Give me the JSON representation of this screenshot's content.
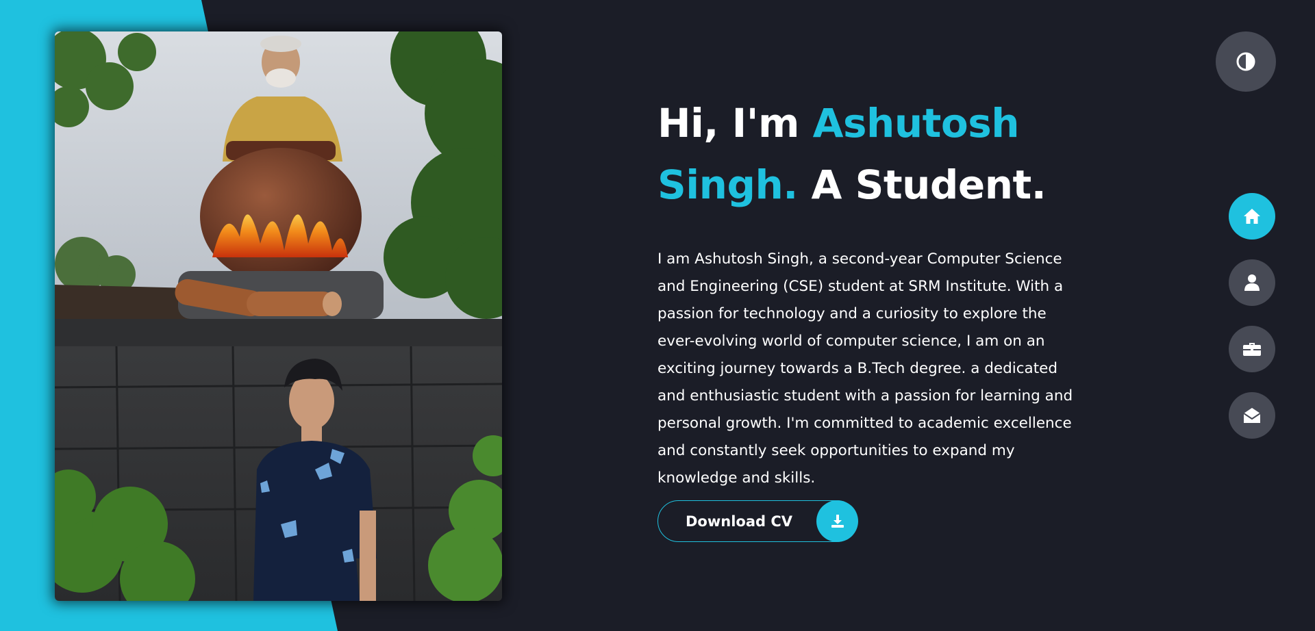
{
  "hero": {
    "greeting": "Hi, I'm ",
    "name_first": "Ashutosh",
    "name_last": "Singh.",
    "role": " A Student.",
    "bio": "I am Ashutosh Singh, a second-year Computer Science and Engineering (CSE) student at SRM Institute. With a passion for technology and a curiosity to explore the ever-evolving world of computer science, I am on an exciting journey towards a B.Tech degree. a dedicated and enthusiastic student with a passion for learning and personal growth. I'm committed to academic excellence and constantly seek opportunities to expand my knowledge and skills.",
    "cv_button_label": "Download CV",
    "cv_button_icon": "download-icon"
  },
  "theme_toggle": {
    "icon": "half-circle-contrast-icon"
  },
  "nav": {
    "active": "home",
    "items": [
      {
        "id": "home",
        "icon": "home-icon"
      },
      {
        "id": "about",
        "icon": "user-icon"
      },
      {
        "id": "portfolio",
        "icon": "briefcase-icon"
      },
      {
        "id": "contact",
        "icon": "envelope-open-icon"
      }
    ]
  },
  "colors": {
    "background": "#1b1d27",
    "accent": "#1fc1df",
    "button_gray": "#474a55",
    "text": "#ffffff"
  }
}
